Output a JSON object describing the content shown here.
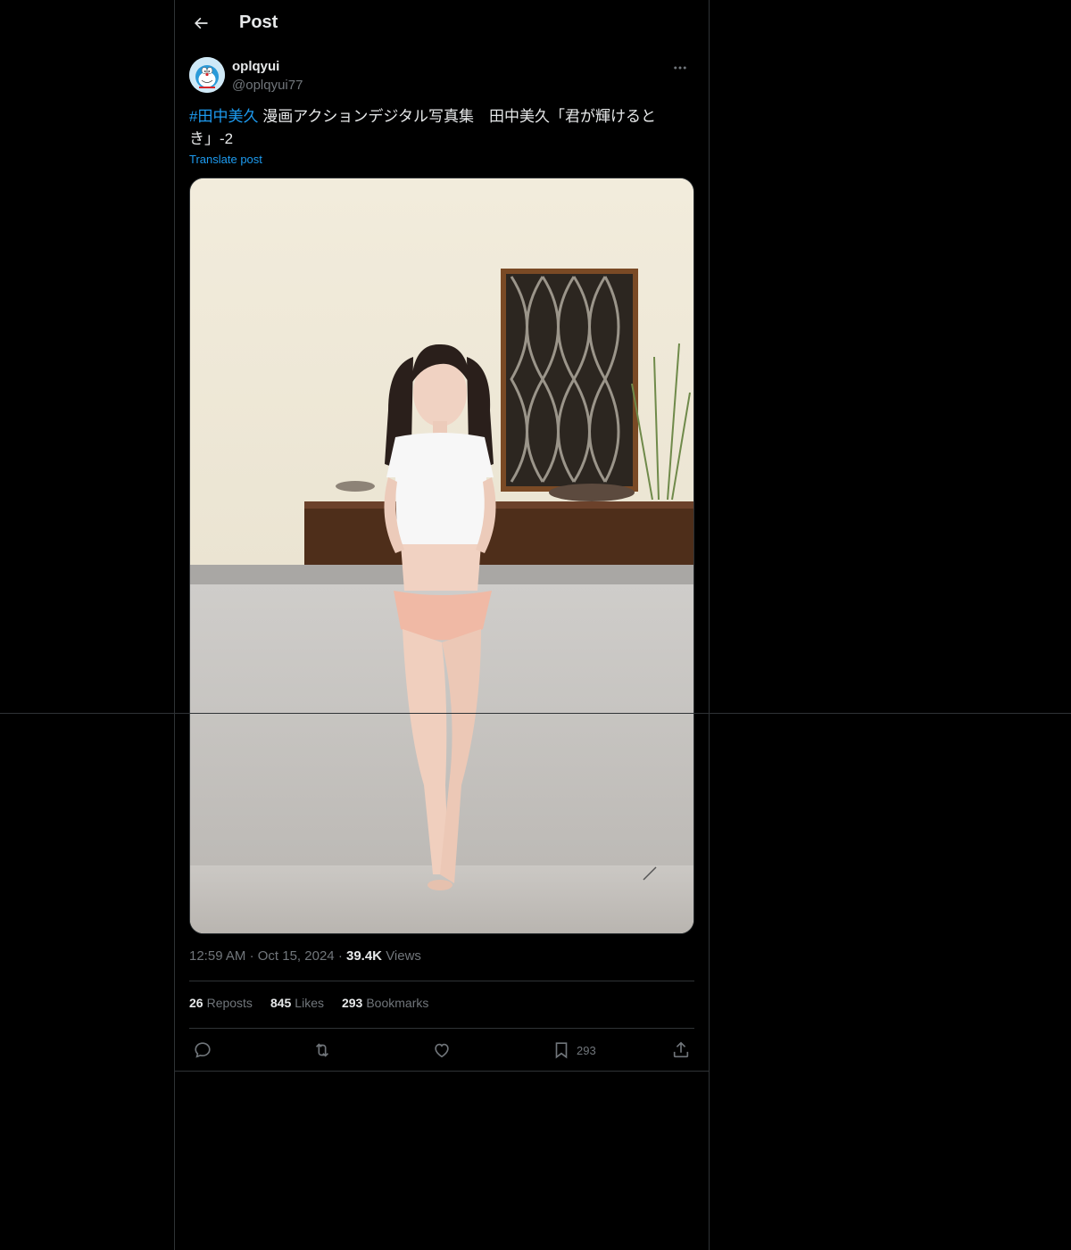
{
  "header": {
    "title": "Post",
    "back_icon": "arrow-left-icon"
  },
  "author": {
    "display_name": "oplqyui",
    "handle": "@oplqyui77",
    "avatar_icon": "doraemon-avatar"
  },
  "post": {
    "hashtag": "#田中美久",
    "text": " 漫画アクションデジタル写真集　田中美久「君が輝けるとき」-2",
    "translate_label": "Translate post"
  },
  "meta": {
    "time": "12:59 AM",
    "dot": "·",
    "date": "Oct 15, 2024",
    "views_count": "39.4K",
    "views_label": "Views"
  },
  "stats": {
    "reposts_count": "26",
    "reposts_label": "Reposts",
    "likes_count": "845",
    "likes_label": "Likes",
    "bookmarks_count": "293",
    "bookmarks_label": "Bookmarks"
  },
  "actions": {
    "bookmark_count": "293"
  },
  "colors": {
    "accent": "#1d9bf0",
    "muted": "#71767b",
    "text": "#e7e9ea",
    "border": "#2f3336",
    "bg": "#000000"
  }
}
